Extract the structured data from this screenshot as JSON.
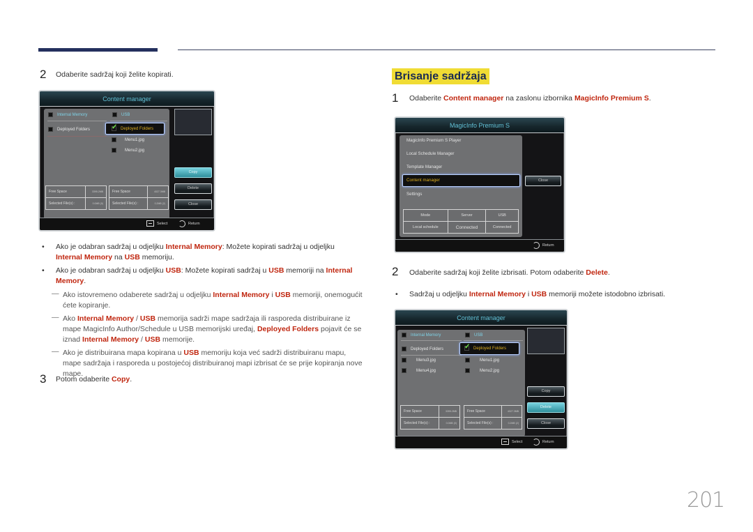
{
  "page": {
    "number": "201",
    "left": {
      "step2": {
        "num": "2",
        "text": "Odaberite sadržaj koji želite kopirati."
      },
      "bullets": [
        {
          "parts": [
            {
              "t": "Ako je odabran sadržaj u odjeljku "
            },
            {
              "t": "Internal Memory",
              "hl": true
            },
            {
              "t": ": Možete kopirati sadržaj u odjeljku "
            },
            {
              "t": "Internal Memory",
              "hl": true
            },
            {
              "t": " na "
            },
            {
              "t": "USB",
              "hl": true
            },
            {
              "t": " memoriju."
            }
          ]
        },
        {
          "parts": [
            {
              "t": "Ako je odabran sadržaj u odjeljku "
            },
            {
              "t": "USB",
              "hl": true
            },
            {
              "t": ": Možete kopirati sadržaj u "
            },
            {
              "t": "USB",
              "hl": true
            },
            {
              "t": " memoriji na "
            },
            {
              "t": "Internal Memory",
              "hl": true
            },
            {
              "t": "."
            }
          ]
        }
      ],
      "notes": [
        {
          "parts": [
            {
              "t": "Ako istovremeno odaberete sadržaj u odjeljku "
            },
            {
              "t": "Internal Memory",
              "hl": true
            },
            {
              "t": " i "
            },
            {
              "t": "USB",
              "hl": true
            },
            {
              "t": " memoriji, onemogućit ćete kopiranje."
            }
          ]
        },
        {
          "parts": [
            {
              "t": "Ako "
            },
            {
              "t": "Internal Memory",
              "hl": true
            },
            {
              "t": " / "
            },
            {
              "t": "USB",
              "hl": true
            },
            {
              "t": " memorija sadrži mape sadržaja ili rasporeda distribuirane iz mape MagicInfo Author/Schedule u USB memorijski uređaj, "
            },
            {
              "t": "Deployed Folders",
              "hl": true
            },
            {
              "t": " pojavit će se iznad "
            },
            {
              "t": "Internal Memory",
              "hl": true
            },
            {
              "t": " / "
            },
            {
              "t": "USB",
              "hl": true
            },
            {
              "t": " memorije."
            }
          ]
        },
        {
          "parts": [
            {
              "t": "Ako je distribuirana mapa kopirana u "
            },
            {
              "t": "USB",
              "hl": true
            },
            {
              "t": " memoriju koja već sadrži distribuiranu mapu, mape sadržaja i rasporeda u postojećoj distribuiranoj mapi izbrisat će se prije kopiranja nove mape."
            }
          ]
        }
      ],
      "step3": {
        "num": "3",
        "prefix": "Potom odaberite ",
        "action": "Copy",
        "suffix": "."
      }
    },
    "right": {
      "section_title": "Brisanje sadržaja",
      "step1": {
        "num": "1",
        "prefix": "Odaberite ",
        "hl1": "Content manager",
        "mid": " na zaslonu izbornika ",
        "hl2": "MagicInfo Premium S",
        "suffix": "."
      },
      "step2": {
        "num": "2",
        "prefix": "Odaberite sadržaj koji želite izbrisati. Potom odaberite ",
        "action": "Delete",
        "suffix": "."
      },
      "bullet": {
        "parts": [
          {
            "t": "Sadržaj u odjeljku "
          },
          {
            "t": "Internal Memory",
            "hl": true
          },
          {
            "t": " i "
          },
          {
            "t": "USB",
            "hl": true
          },
          {
            "t": " memoriji možete istodobno izbrisati."
          }
        ]
      }
    }
  },
  "copy_screen": {
    "title": "Content manager",
    "internal_header": "Internal Memory",
    "usb_header": "USB",
    "internal_items": [
      "Deployed Folders"
    ],
    "usb_items": [
      "Deployed Folders",
      "Menu1.jpg",
      "Menu2.jpg"
    ],
    "free_space_label": "Free Space",
    "selected_label": "Selected File(s) :",
    "internal_free": "3395.2MB",
    "internal_selected": "0.0MB (0)",
    "usb_free": "4027.3MB",
    "usb_selected": "0.2MB (2)",
    "buttons": [
      "Copy",
      "Delete",
      "Close"
    ],
    "active_button": "Copy",
    "footer": {
      "select": "Select",
      "return": "Return"
    }
  },
  "magicinfo_screen": {
    "title": "MagicInfo Premium S",
    "menu": [
      "MagicInfo Premium S Player",
      "Local Schedule Manager",
      "Template Manager",
      "Content manager",
      "Settings"
    ],
    "selected_menu": "Content manager",
    "close_button": "Close",
    "status": {
      "headers": [
        "Mode",
        "Server",
        "USB"
      ],
      "values": [
        "Local schedule",
        "Connected",
        "Connected"
      ]
    },
    "footer": {
      "return": "Return"
    }
  },
  "delete_screen": {
    "title": "Content manager",
    "internal_header": "Internal Memory",
    "usb_header": "USB",
    "internal_items": [
      "Deployed Folders",
      "Menu3.jpg",
      "Menu4.jpg"
    ],
    "usb_items": [
      "Deployed Folders",
      "Menu1.jpg",
      "Menu2.jpg"
    ],
    "free_space_label": "Free Space",
    "selected_label": "Selected File(s) :",
    "internal_free": "3395.2MB",
    "internal_selected": "0.0MB (0)",
    "usb_free": "4027.3MB",
    "usb_selected": "0.2MB (2)",
    "buttons": [
      "Copy",
      "Delete",
      "Close"
    ],
    "active_button": "Delete",
    "footer": {
      "select": "Select",
      "return": "Return"
    }
  }
}
